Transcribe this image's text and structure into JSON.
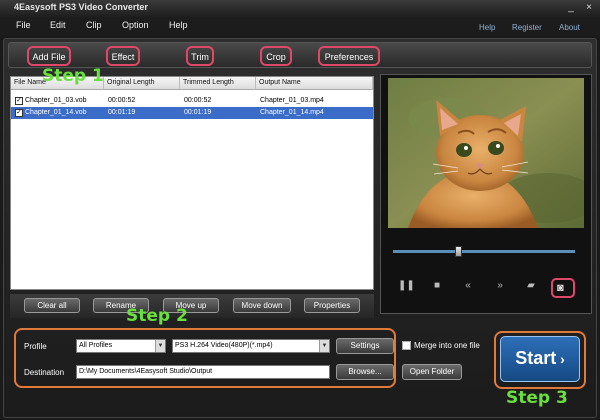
{
  "window": {
    "title": "4Easysoft PS3 Video Converter",
    "minimize": "_",
    "close": "×"
  },
  "menu": [
    "File",
    "Edit",
    "Clip",
    "Option",
    "Help"
  ],
  "links": [
    "Help",
    "Register",
    "About"
  ],
  "toolbar": [
    "Add File",
    "Effect",
    "Trim",
    "Crop",
    "Preferences"
  ],
  "table": {
    "headers": [
      "File Name",
      "Original Length",
      "Trimmed Length",
      "Output Name"
    ],
    "rows": [
      {
        "name": "Chapter_01_03.vob",
        "original": "00:00:52",
        "trimmed": "00:00:52",
        "output": "Chapter_01_03.mp4",
        "checked": true,
        "selected": false
      },
      {
        "name": "Chapter_01_14.vob",
        "original": "00:01:19",
        "trimmed": "00:01:19",
        "output": "Chapter_01_14.mp4",
        "checked": true,
        "selected": true
      }
    ]
  },
  "list_buttons": [
    "Clear all",
    "Rename",
    "Move up",
    "Move down",
    "Properties"
  ],
  "steps": [
    "Step 1",
    "Step 2",
    "Step 3"
  ],
  "preview": {
    "seek_position": 0.34,
    "controls": [
      "pause-icon",
      "stop-icon",
      "rewind-icon",
      "forward-icon",
      "folder-icon",
      "snapshot-icon"
    ]
  },
  "settings": {
    "profile_label": "Profile",
    "profile_category": "All Profiles",
    "profile_format": "PS3 H.264 Video(480P)(*.mp4)",
    "settings_button": "Settings",
    "merge_label": "Merge into one file",
    "destination_label": "Destination",
    "destination_value": "D:\\My Documents\\4Easysoft Studio\\Output",
    "browse_button": "Browse...",
    "open_folder_button": "Open Folder"
  },
  "start_button": "Start",
  "colors": {
    "highlight_red": "#e0486a",
    "highlight_orange": "#e07a3a",
    "step_green": "#69e03c",
    "selection_blue": "#3a6cc8",
    "start_blue": "#2d6fb8"
  }
}
